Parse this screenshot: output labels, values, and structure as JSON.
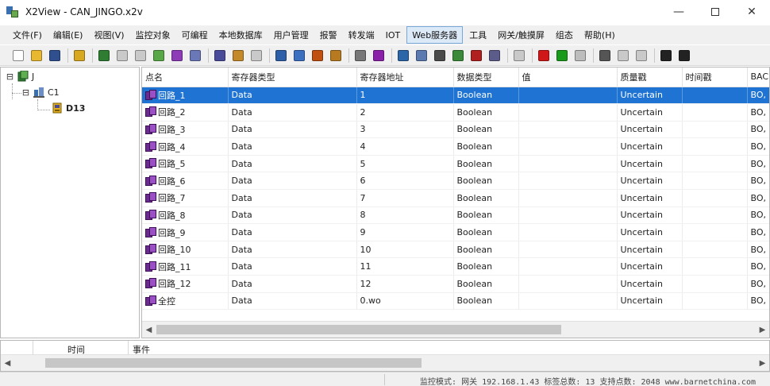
{
  "window": {
    "title": "X2View - CAN_JINGO.x2v",
    "minimize_glyph": "—",
    "close_glyph": "✕"
  },
  "menu": {
    "items": [
      {
        "label": "文件(F)"
      },
      {
        "label": "编辑(E)"
      },
      {
        "label": "视图(V)"
      },
      {
        "label": "监控对象"
      },
      {
        "label": "可编程"
      },
      {
        "label": "本地数据库"
      },
      {
        "label": "用户管理"
      },
      {
        "label": "报警"
      },
      {
        "label": "转发端"
      },
      {
        "label": "IOT"
      },
      {
        "label": "Web服务器",
        "active": true
      },
      {
        "label": "工具"
      },
      {
        "label": "网关/触摸屏"
      },
      {
        "label": "组态"
      },
      {
        "label": "帮助(H)"
      }
    ]
  },
  "toolbar": {
    "buttons": [
      {
        "name": "new-file-icon",
        "color": "#ffffff"
      },
      {
        "name": "open-folder-icon",
        "color": "#e8b830"
      },
      {
        "name": "save-icon",
        "color": "#2f4f8f"
      },
      {
        "name": "key-icon",
        "color": "#d8a820"
      },
      {
        "name": "add-device-icon",
        "color": "#2e7d32"
      },
      {
        "name": "device-icon-disabled",
        "color": "#c9c9c9"
      },
      {
        "name": "channel-icon-disabled",
        "color": "#c9c9c9"
      },
      {
        "name": "add-channel-icon",
        "color": "#58a848"
      },
      {
        "name": "add-points-icon",
        "color": "#8e3bb8"
      },
      {
        "name": "edit-icon",
        "color": "#6a78b8"
      },
      {
        "name": "cut-icon",
        "color": "#4a4a9a"
      },
      {
        "name": "copy-icon",
        "color": "#c48a2a"
      },
      {
        "name": "paste-icon-disabled",
        "color": "#c9c9c9"
      },
      {
        "name": "import-icon",
        "color": "#2b5fa8"
      },
      {
        "name": "list-icon",
        "color": "#3b6fc0"
      },
      {
        "name": "clock-icon",
        "color": "#c05010"
      },
      {
        "name": "tools-icon",
        "color": "#b87a20"
      },
      {
        "name": "table-icon",
        "color": "#777777"
      },
      {
        "name": "bold-b-icon",
        "color": "#8a1fa8"
      },
      {
        "name": "chart-icon",
        "color": "#2a66a8"
      },
      {
        "name": "monitor-icon",
        "color": "#5a7ab0"
      },
      {
        "name": "script-icon",
        "color": "#4a4a4a"
      },
      {
        "name": "network-icon",
        "color": "#3a8a3a"
      },
      {
        "name": "record-icon",
        "color": "#b02020"
      },
      {
        "name": "gateway-icon",
        "color": "#5c5c8a"
      },
      {
        "name": "refresh-icon-disabled",
        "color": "#c9c9c9"
      },
      {
        "name": "run-red-icon",
        "color": "#d01818"
      },
      {
        "name": "play-icon",
        "color": "#1a9a1a"
      },
      {
        "name": "stop-icon-disabled",
        "color": "#bdbdbd"
      },
      {
        "name": "wrench-icon",
        "color": "#555555"
      },
      {
        "name": "disabled-tool-icon-1",
        "color": "#c9c9c9"
      },
      {
        "name": "disabled-tool-icon-2",
        "color": "#c9c9c9"
      },
      {
        "name": "display-icon",
        "color": "#222222"
      },
      {
        "name": "settings-icon",
        "color": "#222222"
      }
    ]
  },
  "tree": {
    "root": {
      "label": "J",
      "expander": "⊟"
    },
    "channel": {
      "label": "C1",
      "expander": "⊟"
    },
    "device": {
      "label": "D13"
    }
  },
  "grid": {
    "columns": [
      "点名",
      "寄存器类型",
      "寄存器地址",
      "数据类型",
      "值",
      "质量戳",
      "时间戳",
      "BAC"
    ],
    "rows": [
      {
        "name": "回路_1",
        "reg_type": "Data",
        "reg_addr": "1",
        "data_type": "Boolean",
        "value": "",
        "quality": "Uncertain",
        "time": "",
        "bac": "BO,"
      },
      {
        "name": "回路_2",
        "reg_type": "Data",
        "reg_addr": "2",
        "data_type": "Boolean",
        "value": "",
        "quality": "Uncertain",
        "time": "",
        "bac": "BO,"
      },
      {
        "name": "回路_3",
        "reg_type": "Data",
        "reg_addr": "3",
        "data_type": "Boolean",
        "value": "",
        "quality": "Uncertain",
        "time": "",
        "bac": "BO,"
      },
      {
        "name": "回路_4",
        "reg_type": "Data",
        "reg_addr": "4",
        "data_type": "Boolean",
        "value": "",
        "quality": "Uncertain",
        "time": "",
        "bac": "BO,"
      },
      {
        "name": "回路_5",
        "reg_type": "Data",
        "reg_addr": "5",
        "data_type": "Boolean",
        "value": "",
        "quality": "Uncertain",
        "time": "",
        "bac": "BO,"
      },
      {
        "name": "回路_6",
        "reg_type": "Data",
        "reg_addr": "6",
        "data_type": "Boolean",
        "value": "",
        "quality": "Uncertain",
        "time": "",
        "bac": "BO,"
      },
      {
        "name": "回路_7",
        "reg_type": "Data",
        "reg_addr": "7",
        "data_type": "Boolean",
        "value": "",
        "quality": "Uncertain",
        "time": "",
        "bac": "BO,"
      },
      {
        "name": "回路_8",
        "reg_type": "Data",
        "reg_addr": "8",
        "data_type": "Boolean",
        "value": "",
        "quality": "Uncertain",
        "time": "",
        "bac": "BO,"
      },
      {
        "name": "回路_9",
        "reg_type": "Data",
        "reg_addr": "9",
        "data_type": "Boolean",
        "value": "",
        "quality": "Uncertain",
        "time": "",
        "bac": "BO,"
      },
      {
        "name": "回路_10",
        "reg_type": "Data",
        "reg_addr": "10",
        "data_type": "Boolean",
        "value": "",
        "quality": "Uncertain",
        "time": "",
        "bac": "BO,"
      },
      {
        "name": "回路_11",
        "reg_type": "Data",
        "reg_addr": "11",
        "data_type": "Boolean",
        "value": "",
        "quality": "Uncertain",
        "time": "",
        "bac": "BO,"
      },
      {
        "name": "回路_12",
        "reg_type": "Data",
        "reg_addr": "12",
        "data_type": "Boolean",
        "value": "",
        "quality": "Uncertain",
        "time": "",
        "bac": "BO,"
      },
      {
        "name": "全控",
        "reg_type": "Data",
        "reg_addr": "0.wo",
        "data_type": "Boolean",
        "value": "",
        "quality": "Uncertain",
        "time": "",
        "bac": "BO,"
      }
    ],
    "selected_row": 0
  },
  "log": {
    "col_time": "时间",
    "col_event": "事件"
  },
  "status": {
    "text": "监控模式: 网关 192.168.1.43 标签总数: 13 支持点数: 2048 www.barnetchina.com"
  },
  "colors": {
    "selection": "#1f73d2",
    "menu_active_bg": "#dce9f7",
    "chrome_bg": "#f0f0f0"
  }
}
